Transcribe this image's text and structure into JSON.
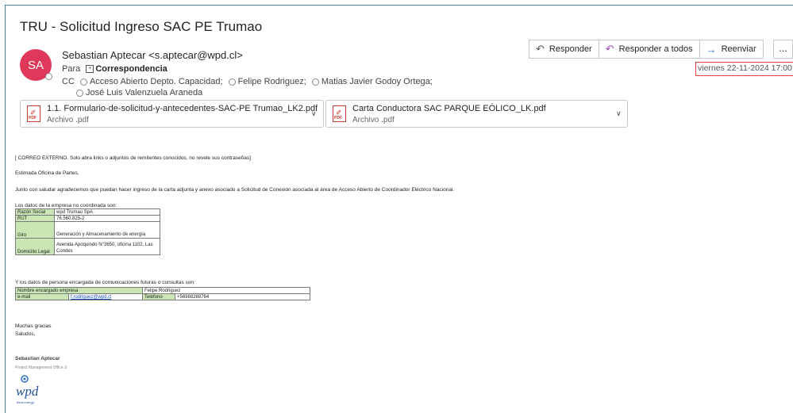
{
  "subject": "TRU - Solicitud Ingreso SAC PE Trumao",
  "sender": {
    "initials": "SA",
    "display": "Sebastian Aptecar <s.aptecar@wpd.cl>"
  },
  "to": {
    "label": "Para",
    "value": "Correspondencia"
  },
  "cc": {
    "label": "CC",
    "recipients": [
      "Acceso Abierto Depto. Capacidad;",
      "Felipe Rodriguez;",
      "Matias Javier Godoy Ortega;",
      "José Luis Valenzuela Araneda"
    ]
  },
  "toolbar": {
    "reply": "Responder",
    "reply_all": "Responder a todos",
    "forward": "Reenviar",
    "more": "..."
  },
  "date": "viernes 22-11-2024 17:00",
  "attachments": [
    {
      "name": "1.1. Formulario-de-solicitud-y-antecedentes-SAC-PE Trumao_LK2.pdf",
      "type": "Archivo .pdf"
    },
    {
      "name": "Carta Conductora SAC PARQUE EÓLICO_LK.pdf",
      "type": "Archivo .pdf"
    }
  ],
  "body": {
    "warning": "[ CORREO EXTERNO. Solo abra links o adjuntos de remitentes conocidos, no revele sus contraseñas]",
    "greeting": "Estimada Oficina de Partes,",
    "paragraph": "Junto con saludar agradecemos que puedan hacer ingreso de la carta adjunta y anexo asociado a Solicitud de Conexión asociada al área de Acceso Abierto de Coordinador Eléctrico Nacional.",
    "company_intro": "Los datos de la empresa no coordinada son:",
    "company_table": [
      {
        "label": "Razón Social",
        "value": "wpd Trumao SpA"
      },
      {
        "label": "RUT",
        "value": "76.560.825-2"
      },
      {
        "label": "Giro",
        "value": "Generación y Almacenamiento de energía"
      },
      {
        "label": "Domicilio Legal",
        "value": "Avenida Apoquindo N°3650, oficina 1102, Las Condes"
      }
    ],
    "contact_intro": "Y los datos de persona encargada de comunicaciones futuras o consultas son:",
    "contact": {
      "name_label": "Nombre encargado empresa",
      "name_value": "Felipe Rodriguez",
      "email_label": "e-mail",
      "email_value": "f.rodriguez@wpd.cl",
      "phone_label": "Teléfono",
      "phone_value": "+56988288764"
    },
    "thanks": "Muchas gracias",
    "regards": "Saludos,",
    "sig_name": "Sebastian Aptecar",
    "sig_title": "Project Management Office Jr",
    "logo_text": "wpd",
    "logo_sub": "think energy"
  }
}
